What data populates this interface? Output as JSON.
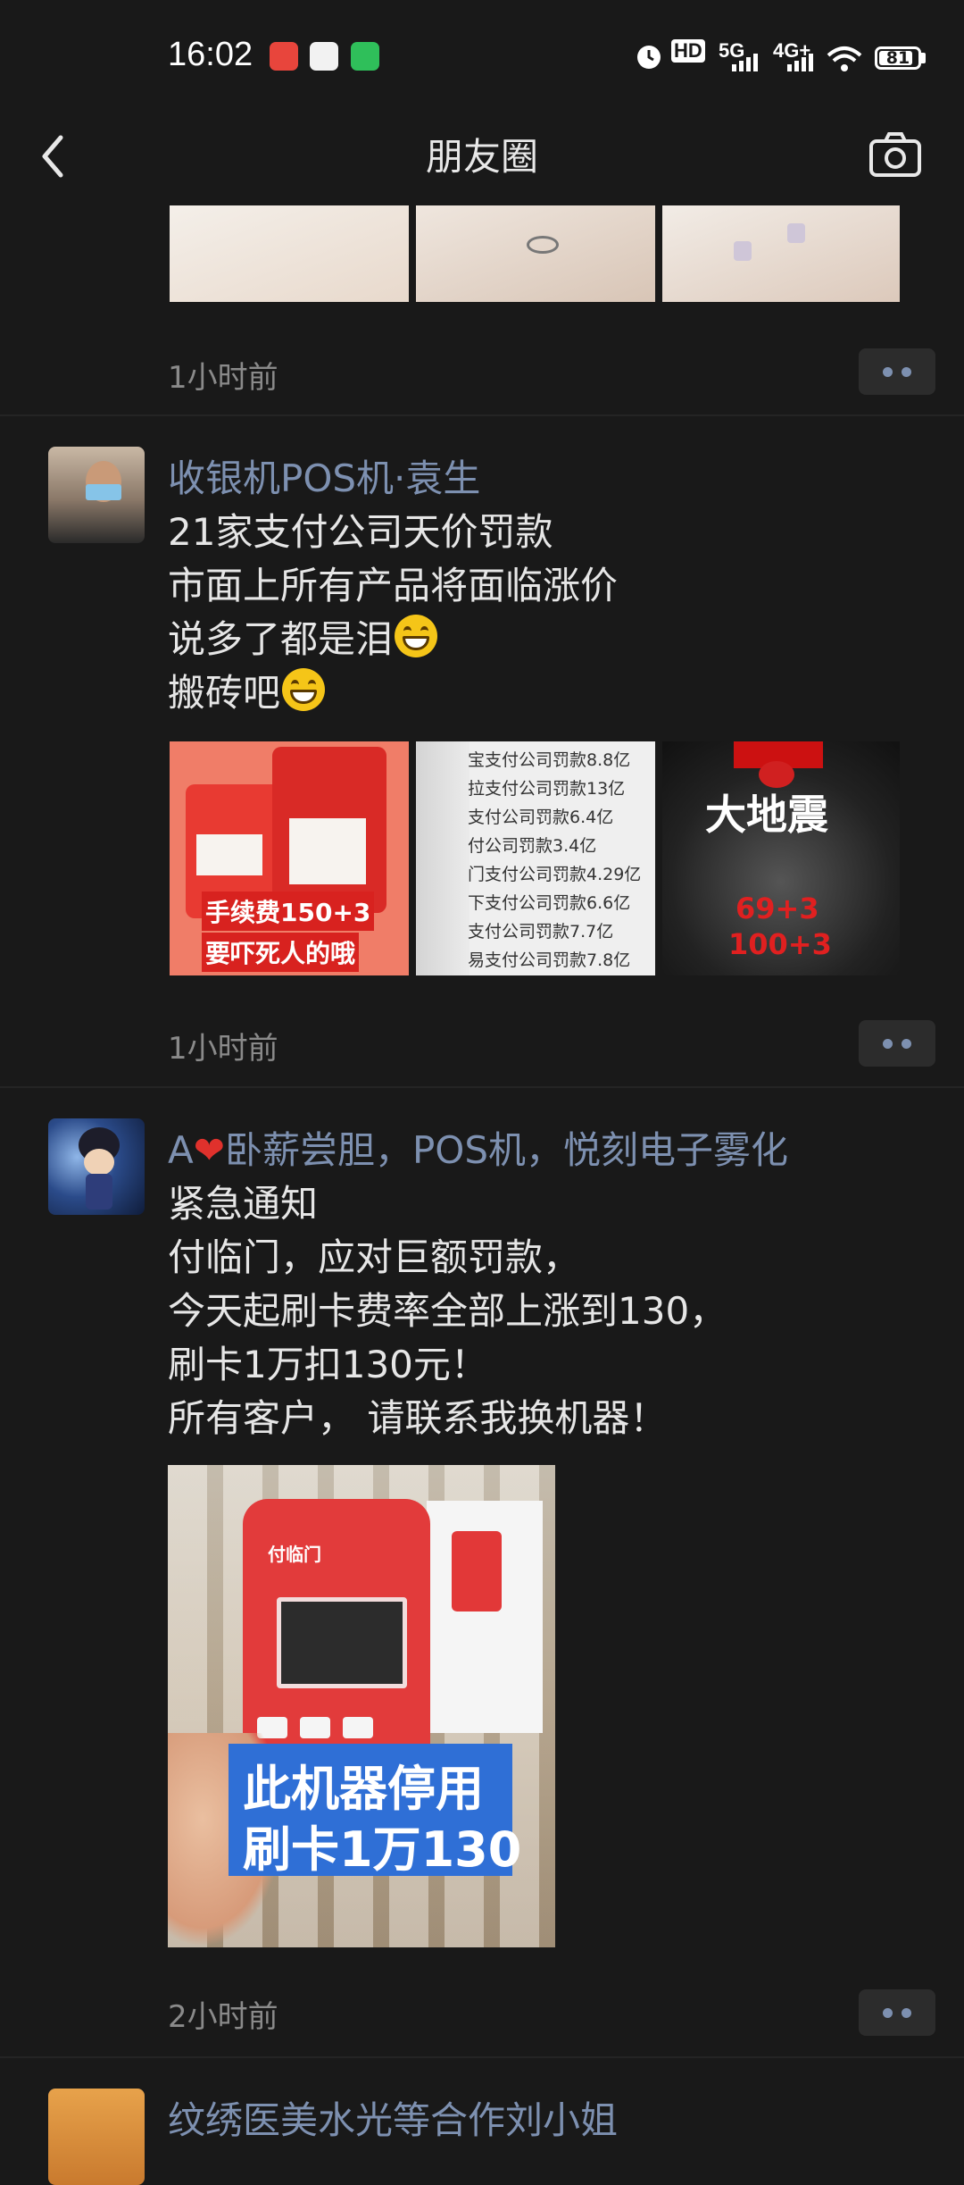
{
  "status_bar": {
    "time": "16:02",
    "hd_label": "HD",
    "net1": "5G",
    "net2": "4G+",
    "battery": "81",
    "battery_level": 0.81
  },
  "nav": {
    "title": "朋友圈"
  },
  "posts": [
    {
      "timestamp": "1小时前"
    },
    {
      "author": "收银机POS机·袁生",
      "lines": [
        "21家支付公司天价罚款",
        "市面上所有产品将面临涨价",
        "说多了都是泪",
        "搬砖吧"
      ],
      "images": [
        {
          "overlay": [
            "手续费150+3",
            "要吓死人的哦"
          ]
        },
        {
          "rows": [
            "宝支付公司罚款8.8亿",
            "拉支付公司罚款13亿",
            "支付公司罚款6.4亿",
            "付公司罚款3.4亿",
            "门支付公司罚款4.29亿",
            "下支付公司罚款6.6亿",
            "支付公司罚款7.7亿",
            "易支付公司罚款7.8亿"
          ]
        },
        {
          "headline": "大地震",
          "figures": [
            "69+3",
            "100+3"
          ]
        }
      ],
      "timestamp": "1小时前"
    },
    {
      "author_prefix": "A",
      "author_rest": "卧薪尝胆，POS机，悦刻电子雾化",
      "lines": [
        "紧急通知",
        "付临门，应对巨额罚款，",
        "今天起刷卡费率全部上涨到130，",
        "刷卡1万扣130元！",
        "所有客户， 请联系我换机器！"
      ],
      "image_overlay": [
        "此机器停用",
        "刷卡1万130"
      ],
      "device_brand": "付临门",
      "timestamp": "2小时前"
    },
    {
      "author": "纹绣医美水光等合作刘小姐"
    }
  ]
}
